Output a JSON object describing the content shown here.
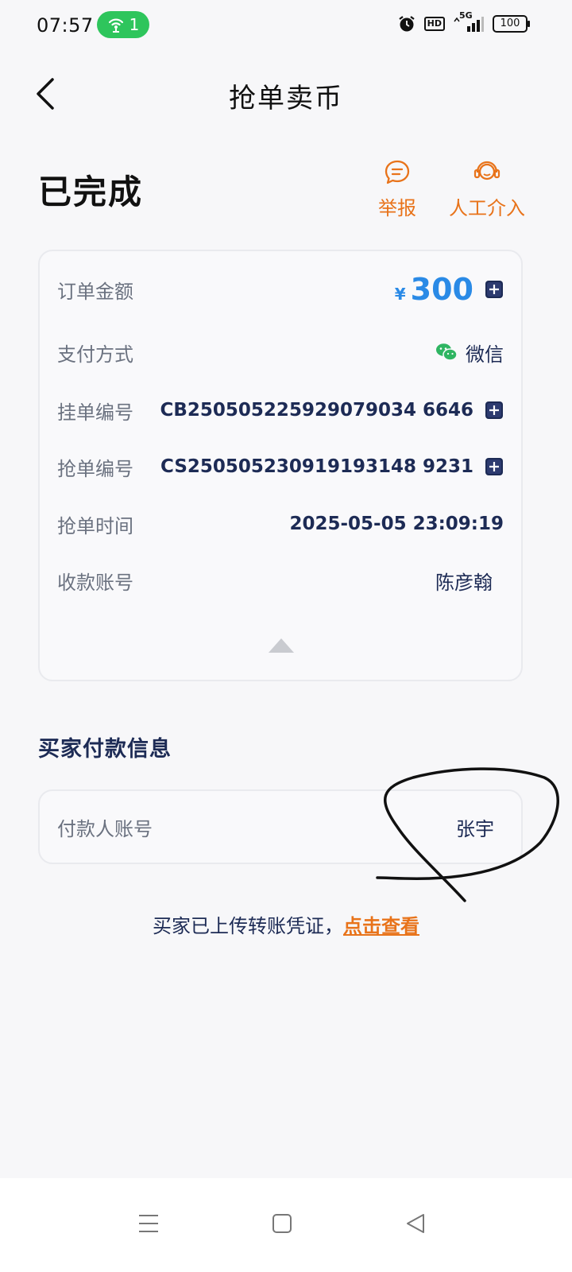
{
  "status_bar": {
    "time": "07:57",
    "hotspot_count": "1",
    "hd_label": "HD",
    "network": "5G",
    "battery": "100"
  },
  "header": {
    "title": "抢单卖币"
  },
  "order": {
    "status": "已完成",
    "actions": {
      "report_label": "举报",
      "support_label": "人工介入"
    }
  },
  "details": {
    "amount": {
      "label": "订单金额",
      "currency": "¥",
      "value": "300"
    },
    "payment_method": {
      "label": "支付方式",
      "value": "微信"
    },
    "listing_no": {
      "label": "挂单编号",
      "value": "CB250505225929079034 6646"
    },
    "grab_no": {
      "label": "抢单编号",
      "value": "CS250505230919193148 9231"
    },
    "grab_time": {
      "label": "抢单时间",
      "value": "2025-05-05 23:09:19"
    },
    "payee": {
      "label": "收款账号",
      "value": "陈彦翰"
    }
  },
  "buyer_payment": {
    "section_title": "买家付款信息",
    "payer_label": "付款人账号",
    "payer_value": "张宇"
  },
  "voucher": {
    "text": "买家已上传转账凭证，",
    "link": "点击查看"
  },
  "colors": {
    "accent_orange": "#e8731a",
    "amount_blue": "#2a8ae6",
    "wechat_green": "#2fb562",
    "text_navy": "#1d2b55",
    "hotspot_green": "#2ec55c"
  }
}
